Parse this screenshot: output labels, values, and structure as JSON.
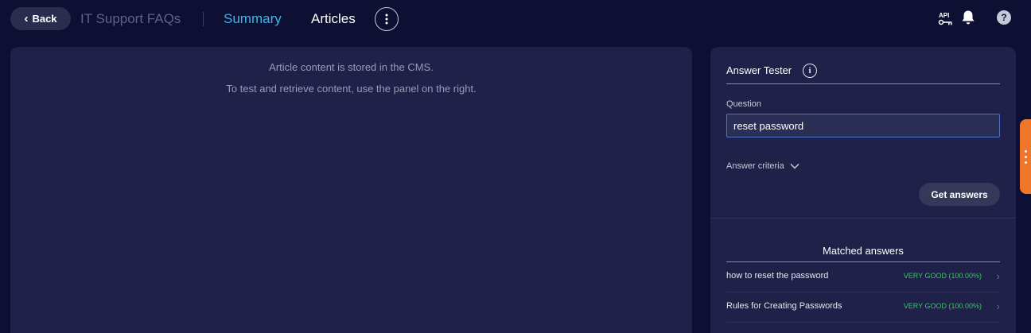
{
  "header": {
    "back_label": "Back",
    "app_title": "IT Support FAQs",
    "tabs": [
      {
        "label": "Summary",
        "active": true
      },
      {
        "label": "Articles",
        "active": false
      }
    ],
    "api_label": "API",
    "help_label": "?"
  },
  "content": {
    "line1": "Article content is stored in the CMS.",
    "line2": "To test and retrieve content, use the panel on the right."
  },
  "tester": {
    "title": "Answer Tester",
    "info_label": "i",
    "question_label": "Question",
    "question_value": "reset password",
    "criteria_label": "Answer criteria",
    "get_answers_label": "Get answers",
    "matched_title": "Matched answers",
    "answers": [
      {
        "text": "how to reset the password",
        "score": "VERY GOOD (100.00%)"
      },
      {
        "text": "Rules for Creating Passwords",
        "score": "VERY GOOD (100.00%)"
      }
    ]
  },
  "colors": {
    "background": "#0d0f33",
    "panel": "#1f2148",
    "accent": "#3fb4e8",
    "score_good": "#3fc26b",
    "side_tab": "#f0762a"
  },
  "icons": [
    "chevron-left-icon",
    "more-vertical-icon",
    "api-key-icon",
    "bell-icon",
    "help-icon",
    "info-icon",
    "chevron-down-icon",
    "chevron-right-icon"
  ]
}
